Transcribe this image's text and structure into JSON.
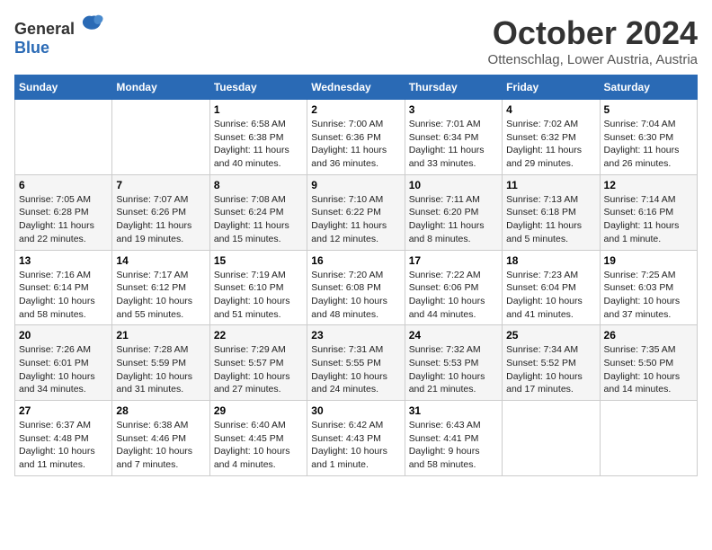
{
  "logo": {
    "general": "General",
    "blue": "Blue"
  },
  "header": {
    "month": "October 2024",
    "location": "Ottenschlag, Lower Austria, Austria"
  },
  "weekdays": [
    "Sunday",
    "Monday",
    "Tuesday",
    "Wednesday",
    "Thursday",
    "Friday",
    "Saturday"
  ],
  "weeks": [
    [
      {
        "day": "",
        "info": ""
      },
      {
        "day": "",
        "info": ""
      },
      {
        "day": "1",
        "info": "Sunrise: 6:58 AM\nSunset: 6:38 PM\nDaylight: 11 hours\nand 40 minutes."
      },
      {
        "day": "2",
        "info": "Sunrise: 7:00 AM\nSunset: 6:36 PM\nDaylight: 11 hours\nand 36 minutes."
      },
      {
        "day": "3",
        "info": "Sunrise: 7:01 AM\nSunset: 6:34 PM\nDaylight: 11 hours\nand 33 minutes."
      },
      {
        "day": "4",
        "info": "Sunrise: 7:02 AM\nSunset: 6:32 PM\nDaylight: 11 hours\nand 29 minutes."
      },
      {
        "day": "5",
        "info": "Sunrise: 7:04 AM\nSunset: 6:30 PM\nDaylight: 11 hours\nand 26 minutes."
      }
    ],
    [
      {
        "day": "6",
        "info": "Sunrise: 7:05 AM\nSunset: 6:28 PM\nDaylight: 11 hours\nand 22 minutes."
      },
      {
        "day": "7",
        "info": "Sunrise: 7:07 AM\nSunset: 6:26 PM\nDaylight: 11 hours\nand 19 minutes."
      },
      {
        "day": "8",
        "info": "Sunrise: 7:08 AM\nSunset: 6:24 PM\nDaylight: 11 hours\nand 15 minutes."
      },
      {
        "day": "9",
        "info": "Sunrise: 7:10 AM\nSunset: 6:22 PM\nDaylight: 11 hours\nand 12 minutes."
      },
      {
        "day": "10",
        "info": "Sunrise: 7:11 AM\nSunset: 6:20 PM\nDaylight: 11 hours\nand 8 minutes."
      },
      {
        "day": "11",
        "info": "Sunrise: 7:13 AM\nSunset: 6:18 PM\nDaylight: 11 hours\nand 5 minutes."
      },
      {
        "day": "12",
        "info": "Sunrise: 7:14 AM\nSunset: 6:16 PM\nDaylight: 11 hours\nand 1 minute."
      }
    ],
    [
      {
        "day": "13",
        "info": "Sunrise: 7:16 AM\nSunset: 6:14 PM\nDaylight: 10 hours\nand 58 minutes."
      },
      {
        "day": "14",
        "info": "Sunrise: 7:17 AM\nSunset: 6:12 PM\nDaylight: 10 hours\nand 55 minutes."
      },
      {
        "day": "15",
        "info": "Sunrise: 7:19 AM\nSunset: 6:10 PM\nDaylight: 10 hours\nand 51 minutes."
      },
      {
        "day": "16",
        "info": "Sunrise: 7:20 AM\nSunset: 6:08 PM\nDaylight: 10 hours\nand 48 minutes."
      },
      {
        "day": "17",
        "info": "Sunrise: 7:22 AM\nSunset: 6:06 PM\nDaylight: 10 hours\nand 44 minutes."
      },
      {
        "day": "18",
        "info": "Sunrise: 7:23 AM\nSunset: 6:04 PM\nDaylight: 10 hours\nand 41 minutes."
      },
      {
        "day": "19",
        "info": "Sunrise: 7:25 AM\nSunset: 6:03 PM\nDaylight: 10 hours\nand 37 minutes."
      }
    ],
    [
      {
        "day": "20",
        "info": "Sunrise: 7:26 AM\nSunset: 6:01 PM\nDaylight: 10 hours\nand 34 minutes."
      },
      {
        "day": "21",
        "info": "Sunrise: 7:28 AM\nSunset: 5:59 PM\nDaylight: 10 hours\nand 31 minutes."
      },
      {
        "day": "22",
        "info": "Sunrise: 7:29 AM\nSunset: 5:57 PM\nDaylight: 10 hours\nand 27 minutes."
      },
      {
        "day": "23",
        "info": "Sunrise: 7:31 AM\nSunset: 5:55 PM\nDaylight: 10 hours\nand 24 minutes."
      },
      {
        "day": "24",
        "info": "Sunrise: 7:32 AM\nSunset: 5:53 PM\nDaylight: 10 hours\nand 21 minutes."
      },
      {
        "day": "25",
        "info": "Sunrise: 7:34 AM\nSunset: 5:52 PM\nDaylight: 10 hours\nand 17 minutes."
      },
      {
        "day": "26",
        "info": "Sunrise: 7:35 AM\nSunset: 5:50 PM\nDaylight: 10 hours\nand 14 minutes."
      }
    ],
    [
      {
        "day": "27",
        "info": "Sunrise: 6:37 AM\nSunset: 4:48 PM\nDaylight: 10 hours\nand 11 minutes."
      },
      {
        "day": "28",
        "info": "Sunrise: 6:38 AM\nSunset: 4:46 PM\nDaylight: 10 hours\nand 7 minutes."
      },
      {
        "day": "29",
        "info": "Sunrise: 6:40 AM\nSunset: 4:45 PM\nDaylight: 10 hours\nand 4 minutes."
      },
      {
        "day": "30",
        "info": "Sunrise: 6:42 AM\nSunset: 4:43 PM\nDaylight: 10 hours\nand 1 minute."
      },
      {
        "day": "31",
        "info": "Sunrise: 6:43 AM\nSunset: 4:41 PM\nDaylight: 9 hours\nand 58 minutes."
      },
      {
        "day": "",
        "info": ""
      },
      {
        "day": "",
        "info": ""
      }
    ]
  ]
}
